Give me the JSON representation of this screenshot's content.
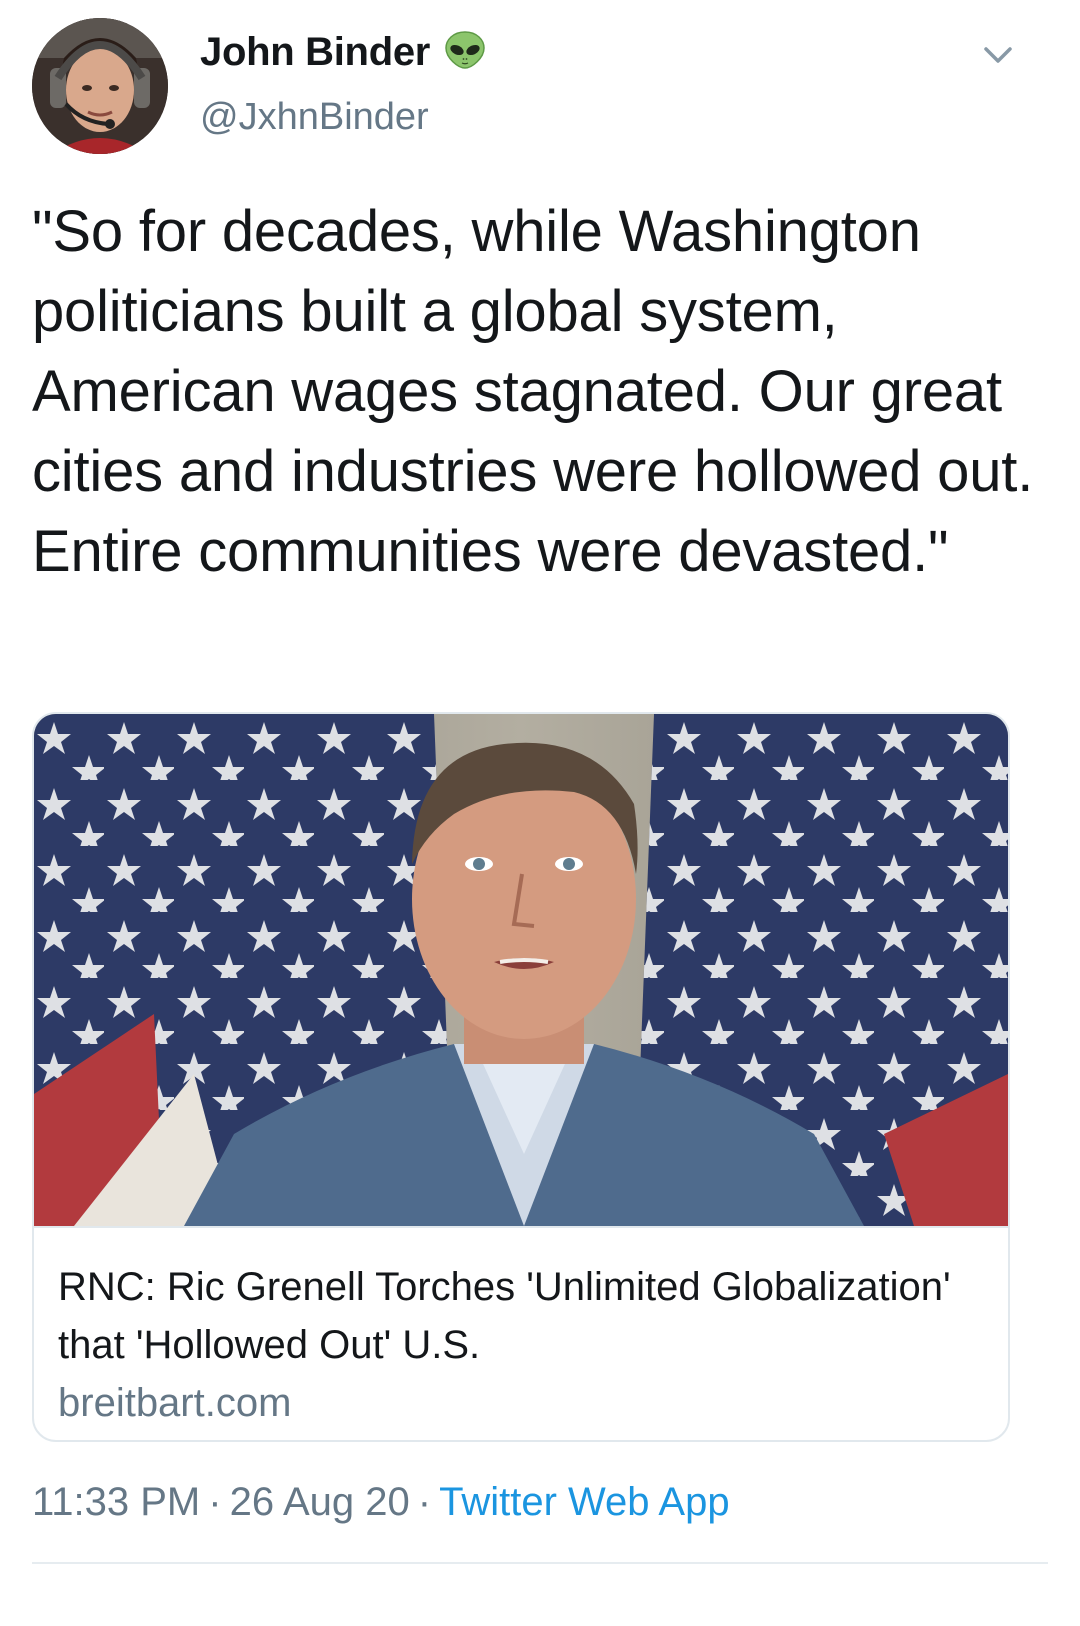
{
  "author": {
    "name": "John Binder",
    "handle": "@JxhnBinder",
    "name_emoji": "alien-icon"
  },
  "tweet": {
    "text": "\"So for decades, while Washington politicians built a global system, American wages stagnated. Our great cities and industries were hollowed out. Entire communities were devasted.\""
  },
  "link_card": {
    "image": "photo-man-in-blue-suit-before-american-flags",
    "title": "RNC: Ric Grenell Torches 'Unlimited Globalization' that 'Hollowed Out' U.S.",
    "domain": "breitbart.com"
  },
  "meta": {
    "time": "11:33 PM",
    "separator": "·",
    "date": "26 Aug 20",
    "source": "Twitter Web App"
  },
  "colors": {
    "text_primary": "#14171a",
    "text_secondary": "#657786",
    "link_blue": "#1b95e0",
    "border": "#e1e8ed"
  }
}
